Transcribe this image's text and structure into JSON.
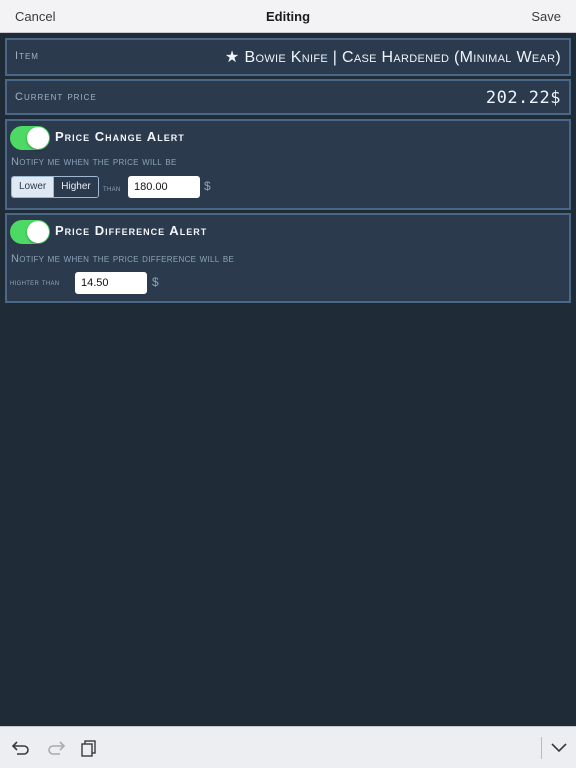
{
  "navbar": {
    "cancel_label": "Cancel",
    "title": "Editing",
    "save_label": "Save"
  },
  "item": {
    "label": "Item",
    "star": "★",
    "value": "Bowie Knife | Case Hardened (Minimal Wear)"
  },
  "current_price": {
    "label": "Current price",
    "value": "202.22$"
  },
  "price_change_alert": {
    "enabled": true,
    "title": "Price Change Alert",
    "notify_text": "Notify me when the price will be",
    "direction_options": [
      "Lower",
      "Higher"
    ],
    "selected_direction": "Lower",
    "than_label": "than",
    "value": "180.00",
    "currency": "$"
  },
  "price_difference_alert": {
    "enabled": true,
    "title": "Price Difference Alert",
    "notify_text": "Notify me when the price difference will be",
    "higher_than_label": "highter than",
    "value": "14.50",
    "currency": "$"
  },
  "toolbar": {
    "icons": [
      "undo-icon",
      "redo-icon",
      "paste-icon",
      "keyboard-dismiss-icon"
    ]
  },
  "colors": {
    "background": "#202b38",
    "panel": "#2b3a4c",
    "panel_border": "#4a6786",
    "toggle_on": "#4cd964"
  }
}
